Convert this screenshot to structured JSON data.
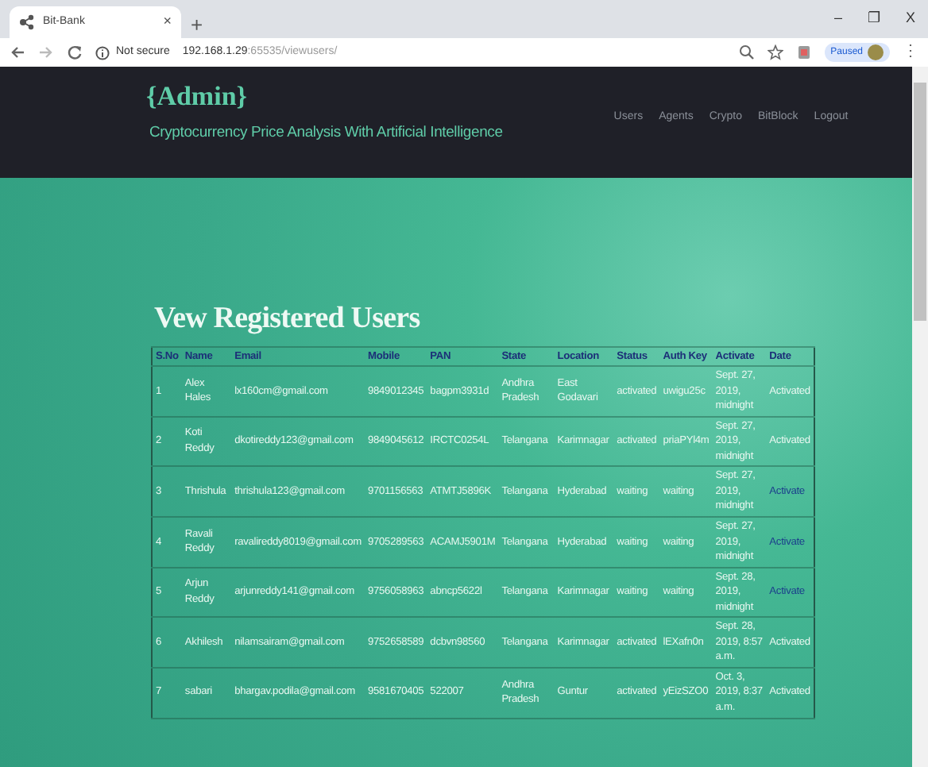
{
  "browser": {
    "tab": {
      "title": "Bit-Bank",
      "close": "×"
    },
    "new_tab": "+",
    "window_controls": [
      "–",
      "❐",
      "X"
    ],
    "address_bar": {
      "security": "Not secure",
      "host": "192.168.1.29",
      "path": ":65535/viewusers/"
    },
    "profile": {
      "label": "Paused"
    },
    "menu": "⋮"
  },
  "navbar": {
    "brand": "{Admin}",
    "subtitle": "Cryptocurrency Price Analysis With Artificial Intelligence",
    "links": [
      "Users",
      "Agents",
      "Crypto",
      "BitBlock",
      "Logout"
    ]
  },
  "heading": "Vew Registered Users",
  "table": {
    "columns": [
      "S.No",
      "Name",
      "Email",
      "Mobile",
      "PAN",
      "State",
      "Location",
      "Status",
      "Auth Key",
      "Activate",
      "Date"
    ],
    "rows": [
      {
        "cells": [
          "1",
          "Alex Hales",
          "lx160cm@gmail.com",
          "9849012345",
          "bagpm3931d",
          "Andhra Pradesh",
          "East Godavari",
          "activated",
          "uwigu25c",
          "Sept. 27, 2019, midnight"
        ],
        "date": {
          "text": "Activated",
          "kind": "text"
        }
      },
      {
        "cells": [
          "2",
          "Koti Reddy",
          "dkotireddy123@gmail.com",
          "9849045612",
          "IRCTC0254L",
          "Telangana",
          "Karimnagar",
          "activated",
          "priaPYl4m",
          "Sept. 27, 2019, midnight"
        ],
        "date": {
          "text": "Activated",
          "kind": "text"
        }
      },
      {
        "cells": [
          "3",
          "Thrishula",
          "thrishula123@gmail.com",
          "9701156563",
          "ATMTJ5896K",
          "Telangana",
          "Hyderabad",
          "waiting",
          "waiting",
          "Sept. 27, 2019, midnight"
        ],
        "date": {
          "text": "Activate",
          "kind": "link"
        }
      },
      {
        "cells": [
          "4",
          "Ravali Reddy",
          "ravalireddy8019@gmail.com",
          "9705289563",
          "ACAMJ5901M",
          "Telangana",
          "Hyderabad",
          "waiting",
          "waiting",
          "Sept. 27, 2019, midnight"
        ],
        "date": {
          "text": "Activate",
          "kind": "link"
        }
      },
      {
        "cells": [
          "5",
          "Arjun Reddy",
          "arjunreddy141@gmail.com",
          "9756058963",
          "abncp5622l",
          "Telangana",
          "Karimnagar",
          "waiting",
          "waiting",
          "Sept. 28, 2019, midnight"
        ],
        "date": {
          "text": "Activate",
          "kind": "link"
        }
      },
      {
        "cells": [
          "6",
          "Akhilesh",
          "nilamsairam@gmail.com",
          "9752658589",
          "dcbvn98560",
          "Telangana",
          "Karimnagar",
          "activated",
          "lEXafn0n",
          "Sept. 28, 2019, 8:57 a.m."
        ],
        "date": {
          "text": "Activated",
          "kind": "text"
        }
      },
      {
        "cells": [
          "7",
          "sabari",
          "bhargav.podila@gmail.com",
          "9581670405",
          "522007",
          "Andhra Pradesh",
          "Guntur",
          "activated",
          "yEizSZO0",
          "Oct. 3, 2019, 8:37 a.m."
        ],
        "date": {
          "text": "Activated",
          "kind": "text"
        }
      }
    ]
  }
}
